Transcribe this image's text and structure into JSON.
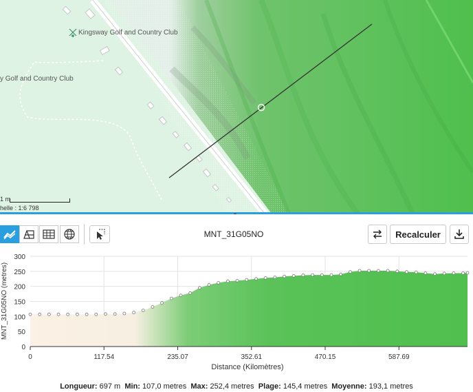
{
  "map": {
    "golf_label_1": "Kingsway Golf and Country Club",
    "golf_label_2": "y Golf and Country Club",
    "scale_distance": "1 m",
    "scale_ratio": "helle : 1:6 798"
  },
  "toolbar": {
    "layer_name": "MNT_31G05NO",
    "recalc_label": "Recalculer"
  },
  "stats": {
    "length_label": "Longueur:",
    "length_value": "697 m",
    "min_label": "Min:",
    "min_value": "107,0 metres",
    "max_label": "Max:",
    "max_value": "252,4 metres",
    "range_label": "Plage:",
    "range_value": "145,4 metres",
    "mean_label": "Moyenne:",
    "mean_value": "193,1 metres"
  },
  "colors": {
    "accent": "#2a9fdf",
    "terrain_green": "#5cc05a",
    "lowland": "#fbf1e4"
  },
  "chart_data": {
    "type": "area",
    "xlabel": "Distance (Kilomètres)",
    "ylabel": "MNT_31G05NO (metres)",
    "x_ticks": [
      "0",
      "117.54",
      "235.07",
      "352.61",
      "470.15",
      "587.69"
    ],
    "x_tick_values": [
      0,
      117.54,
      235.07,
      352.61,
      470.15,
      587.69
    ],
    "y_ticks": [
      "0",
      "50",
      "100",
      "150",
      "200",
      "250",
      "300"
    ],
    "xlim": [
      0,
      697
    ],
    "ylim": [
      0,
      300
    ],
    "grid": true,
    "x": [
      0,
      15,
      30,
      45,
      60,
      75,
      90,
      105,
      120,
      135,
      150,
      165,
      180,
      195,
      210,
      225,
      240,
      255,
      270,
      285,
      300,
      315,
      330,
      345,
      360,
      375,
      390,
      405,
      420,
      435,
      450,
      465,
      480,
      495,
      510,
      525,
      540,
      555,
      570,
      585,
      600,
      615,
      630,
      645,
      660,
      675,
      690,
      697
    ],
    "values": [
      107,
      107,
      107,
      107,
      107,
      107,
      107,
      107,
      108,
      108,
      110,
      113,
      120,
      132,
      145,
      160,
      170,
      178,
      195,
      205,
      212,
      217,
      219,
      222,
      225,
      228,
      230,
      233,
      235,
      237,
      238,
      238,
      238,
      240,
      248,
      252,
      252,
      252,
      252,
      250,
      248,
      247,
      244,
      241,
      243,
      244,
      244,
      245
    ]
  }
}
